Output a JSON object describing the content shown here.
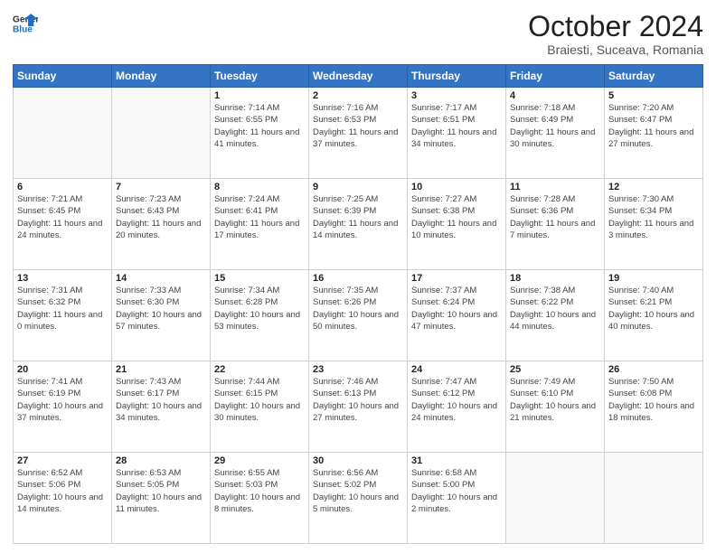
{
  "header": {
    "logo_line1": "General",
    "logo_line2": "Blue",
    "month": "October 2024",
    "location": "Braiesti, Suceava, Romania"
  },
  "weekdays": [
    "Sunday",
    "Monday",
    "Tuesday",
    "Wednesday",
    "Thursday",
    "Friday",
    "Saturday"
  ],
  "weeks": [
    [
      {
        "day": "",
        "info": ""
      },
      {
        "day": "",
        "info": ""
      },
      {
        "day": "1",
        "info": "Sunrise: 7:14 AM\nSunset: 6:55 PM\nDaylight: 11 hours and 41 minutes."
      },
      {
        "day": "2",
        "info": "Sunrise: 7:16 AM\nSunset: 6:53 PM\nDaylight: 11 hours and 37 minutes."
      },
      {
        "day": "3",
        "info": "Sunrise: 7:17 AM\nSunset: 6:51 PM\nDaylight: 11 hours and 34 minutes."
      },
      {
        "day": "4",
        "info": "Sunrise: 7:18 AM\nSunset: 6:49 PM\nDaylight: 11 hours and 30 minutes."
      },
      {
        "day": "5",
        "info": "Sunrise: 7:20 AM\nSunset: 6:47 PM\nDaylight: 11 hours and 27 minutes."
      }
    ],
    [
      {
        "day": "6",
        "info": "Sunrise: 7:21 AM\nSunset: 6:45 PM\nDaylight: 11 hours and 24 minutes."
      },
      {
        "day": "7",
        "info": "Sunrise: 7:23 AM\nSunset: 6:43 PM\nDaylight: 11 hours and 20 minutes."
      },
      {
        "day": "8",
        "info": "Sunrise: 7:24 AM\nSunset: 6:41 PM\nDaylight: 11 hours and 17 minutes."
      },
      {
        "day": "9",
        "info": "Sunrise: 7:25 AM\nSunset: 6:39 PM\nDaylight: 11 hours and 14 minutes."
      },
      {
        "day": "10",
        "info": "Sunrise: 7:27 AM\nSunset: 6:38 PM\nDaylight: 11 hours and 10 minutes."
      },
      {
        "day": "11",
        "info": "Sunrise: 7:28 AM\nSunset: 6:36 PM\nDaylight: 11 hours and 7 minutes."
      },
      {
        "day": "12",
        "info": "Sunrise: 7:30 AM\nSunset: 6:34 PM\nDaylight: 11 hours and 3 minutes."
      }
    ],
    [
      {
        "day": "13",
        "info": "Sunrise: 7:31 AM\nSunset: 6:32 PM\nDaylight: 11 hours and 0 minutes."
      },
      {
        "day": "14",
        "info": "Sunrise: 7:33 AM\nSunset: 6:30 PM\nDaylight: 10 hours and 57 minutes."
      },
      {
        "day": "15",
        "info": "Sunrise: 7:34 AM\nSunset: 6:28 PM\nDaylight: 10 hours and 53 minutes."
      },
      {
        "day": "16",
        "info": "Sunrise: 7:35 AM\nSunset: 6:26 PM\nDaylight: 10 hours and 50 minutes."
      },
      {
        "day": "17",
        "info": "Sunrise: 7:37 AM\nSunset: 6:24 PM\nDaylight: 10 hours and 47 minutes."
      },
      {
        "day": "18",
        "info": "Sunrise: 7:38 AM\nSunset: 6:22 PM\nDaylight: 10 hours and 44 minutes."
      },
      {
        "day": "19",
        "info": "Sunrise: 7:40 AM\nSunset: 6:21 PM\nDaylight: 10 hours and 40 minutes."
      }
    ],
    [
      {
        "day": "20",
        "info": "Sunrise: 7:41 AM\nSunset: 6:19 PM\nDaylight: 10 hours and 37 minutes."
      },
      {
        "day": "21",
        "info": "Sunrise: 7:43 AM\nSunset: 6:17 PM\nDaylight: 10 hours and 34 minutes."
      },
      {
        "day": "22",
        "info": "Sunrise: 7:44 AM\nSunset: 6:15 PM\nDaylight: 10 hours and 30 minutes."
      },
      {
        "day": "23",
        "info": "Sunrise: 7:46 AM\nSunset: 6:13 PM\nDaylight: 10 hours and 27 minutes."
      },
      {
        "day": "24",
        "info": "Sunrise: 7:47 AM\nSunset: 6:12 PM\nDaylight: 10 hours and 24 minutes."
      },
      {
        "day": "25",
        "info": "Sunrise: 7:49 AM\nSunset: 6:10 PM\nDaylight: 10 hours and 21 minutes."
      },
      {
        "day": "26",
        "info": "Sunrise: 7:50 AM\nSunset: 6:08 PM\nDaylight: 10 hours and 18 minutes."
      }
    ],
    [
      {
        "day": "27",
        "info": "Sunrise: 6:52 AM\nSunset: 5:06 PM\nDaylight: 10 hours and 14 minutes."
      },
      {
        "day": "28",
        "info": "Sunrise: 6:53 AM\nSunset: 5:05 PM\nDaylight: 10 hours and 11 minutes."
      },
      {
        "day": "29",
        "info": "Sunrise: 6:55 AM\nSunset: 5:03 PM\nDaylight: 10 hours and 8 minutes."
      },
      {
        "day": "30",
        "info": "Sunrise: 6:56 AM\nSunset: 5:02 PM\nDaylight: 10 hours and 5 minutes."
      },
      {
        "day": "31",
        "info": "Sunrise: 6:58 AM\nSunset: 5:00 PM\nDaylight: 10 hours and 2 minutes."
      },
      {
        "day": "",
        "info": ""
      },
      {
        "day": "",
        "info": ""
      }
    ]
  ]
}
